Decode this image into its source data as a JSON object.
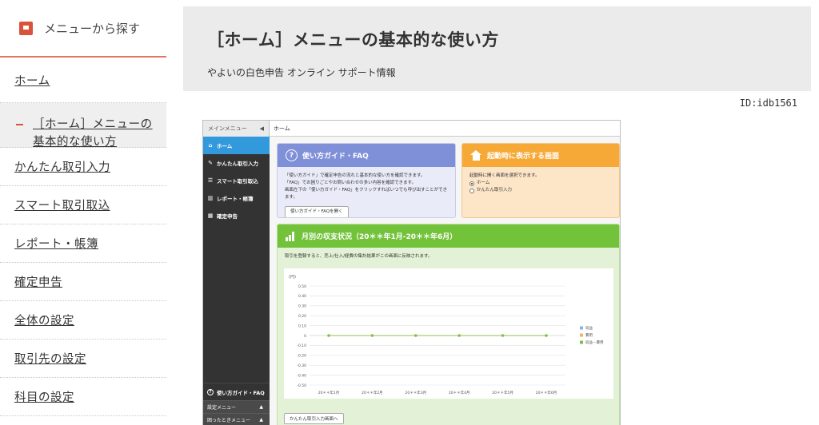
{
  "nav": {
    "header": "メニューから探す",
    "items": [
      {
        "label": "ホーム"
      },
      {
        "label": "［ホーム］メニューの基本的な使い方"
      },
      {
        "label": "かんたん取引入力"
      },
      {
        "label": "スマート取引取込"
      },
      {
        "label": "レポート・帳簿"
      },
      {
        "label": "確定申告"
      },
      {
        "label": "全体の設定"
      },
      {
        "label": "取引先の設定"
      },
      {
        "label": "科目の設定"
      }
    ]
  },
  "header": {
    "title": "［ホーム］メニューの基本的な使い方",
    "subtitle": "やよいの白色申告 オンライン サポート情報"
  },
  "page_id": "ID:idb1561",
  "app": {
    "sidebar_title": "メインメニュー",
    "collapse_glyph": "◀",
    "breadcrumb": "ホーム",
    "menu": [
      {
        "label": "ホーム",
        "icon": "home-icon",
        "glyph": "⌂"
      },
      {
        "label": "かんたん取引入力",
        "icon": "pencil-icon",
        "glyph": "✎"
      },
      {
        "label": "スマート取引取込",
        "icon": "import-icon",
        "glyph": "☰"
      },
      {
        "label": "レポート・帳簿",
        "icon": "report-icon",
        "glyph": "▥"
      },
      {
        "label": "確定申告",
        "icon": "tax-return-icon",
        "glyph": "▦"
      }
    ],
    "faq_label": "使い方ガイド・FAQ",
    "faq_glyph": "?",
    "settings_menu": "設定メニュー",
    "support_menu": "困ったときメニュー",
    "expand_glyph": "▲",
    "guide": {
      "title": "使い方ガイド・FAQ",
      "lines": [
        "「使い方ガイド」で確定申告の流れと基本的な使い方を確認できます。",
        "「FAQ」でお困りごとやお問い合わせの多い内容を確認できます。",
        "画面左下の「使い方ガイド・FAQ」をクリックすればいつでも呼び出すことができます。"
      ],
      "button": "使い方ガイド・FAQを開く"
    },
    "startup": {
      "title": "起動時に表示する画面",
      "description": "起動時に開く画面を選択できます。",
      "options": [
        "ホーム",
        "かんたん取引入力"
      ],
      "selected": "ホーム"
    },
    "monthly": {
      "title": "月別の収支状況（20＊＊年1月-20＊＊年6月）",
      "description": "取引を登録すると、売上/仕入/経費の集計結果がこの画面に反映されます。",
      "button": "かんたん取引入力画面へ"
    }
  },
  "colors": {
    "accent_red": "#d9533b",
    "sidebar_dark": "#333333",
    "active_blue": "#3399dd",
    "guide_blue": "#7f8fd8",
    "startup_orange": "#f7a938",
    "monthly_green": "#72c23a"
  },
  "chart_data": {
    "type": "line",
    "ylabel": "(円)",
    "ylim": [
      -0.5,
      0.5
    ],
    "y_ticks": [
      "0.50",
      "0.40",
      "0.30",
      "0.20",
      "0.10",
      "0",
      "-0.10",
      "-0.20",
      "-0.30",
      "-0.40",
      "-0.50"
    ],
    "categories": [
      "20＊＊年1月",
      "20＊＊年2月",
      "20＊＊年3月",
      "20＊＊年4月",
      "20＊＊年5月",
      "20＊＊年6月"
    ],
    "series": [
      {
        "name": "収益",
        "color": "#8ab4e0",
        "values": [
          0,
          0,
          0,
          0,
          0,
          0
        ]
      },
      {
        "name": "費用",
        "color": "#f2b26b",
        "values": [
          0,
          0,
          0,
          0,
          0,
          0
        ]
      },
      {
        "name": "収益－費用",
        "color": "#7cc04a",
        "values": [
          0,
          0,
          0,
          0,
          0,
          0
        ]
      }
    ],
    "grid": true,
    "legend": "right"
  }
}
